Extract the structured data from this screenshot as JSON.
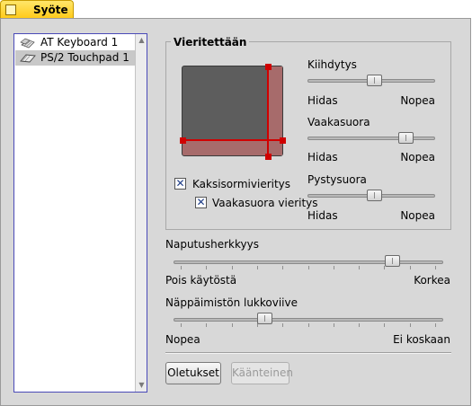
{
  "window": {
    "title": "Syöte"
  },
  "devices": [
    {
      "label": "AT Keyboard 1",
      "icon": "keyboard-icon",
      "selected": false
    },
    {
      "label": "PS/2 Touchpad 1",
      "icon": "touchpad-icon",
      "selected": true
    }
  ],
  "scrolling": {
    "title": "Vieritettään",
    "two_finger_label": "Kaksisormivieritys",
    "two_finger_checked": true,
    "horizontal_label": "Vaakasuora vieritys",
    "horizontal_checked": true
  },
  "sliders": {
    "acceleration": {
      "label": "Kiihdytys",
      "min_label": "Hidas",
      "max_label": "Nopea",
      "value": 0.53
    },
    "horizontal": {
      "label": "Vaakasuora",
      "min_label": "Hidas",
      "max_label": "Nopea",
      "value": 0.81
    },
    "vertical": {
      "label": "Pystysuora",
      "min_label": "Hidas",
      "max_label": "Nopea",
      "value": 0.53
    },
    "tap_sensitivity": {
      "label": "Naputusherkkyys",
      "min_label": "Pois käytöstä",
      "max_label": "Korkea",
      "value": 0.83
    },
    "keyboard_lockout": {
      "label": "Näppäimistön lukkoviive",
      "min_label": "Nopea",
      "max_label": "Ei koskaan",
      "value": 0.33
    }
  },
  "buttons": {
    "defaults": "Oletukset",
    "reverse": "Käänteinen"
  },
  "colors": {
    "accent": "#d00000",
    "title_tab": "#ffcb1b",
    "selection": "#c8c8c8"
  }
}
